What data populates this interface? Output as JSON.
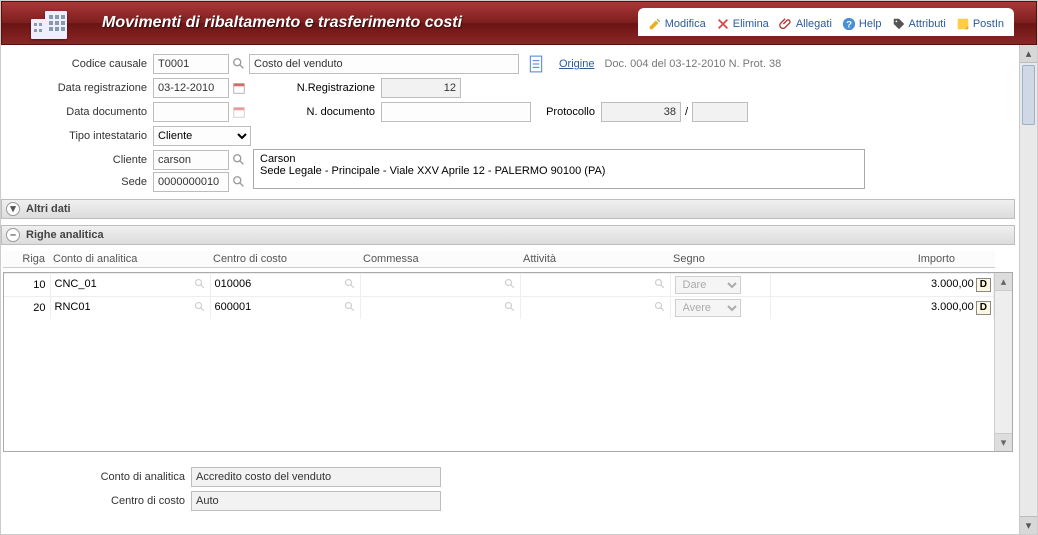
{
  "header": {
    "title": "Movimenti di ribaltamento e trasferimento costi",
    "tools": {
      "modifica": "Modifica",
      "elimina": "Elimina",
      "allegati": "Allegati",
      "help": "Help",
      "attributi": "Attributi",
      "postin": "PostIn"
    }
  },
  "form": {
    "codice_causale_label": "Codice causale",
    "codice_causale": "T0001",
    "codice_causale_desc": "Costo del venduto",
    "origine_label": "Origine",
    "origine_doc": "Doc. 004 del 03-12-2010 N. Prot. 38",
    "data_reg_label": "Data registrazione",
    "data_reg": "03-12-2010",
    "n_reg_label": "N.Registrazione",
    "n_reg": "12",
    "data_doc_label": "Data documento",
    "data_doc": "",
    "n_doc_label": "N. documento",
    "n_doc": "",
    "protocollo_label": "Protocollo",
    "protocollo_a": "38",
    "protocollo_b": "",
    "tipo_int_label": "Tipo intestatario",
    "tipo_int": "Cliente",
    "cliente_label": "Cliente",
    "cliente": "carson",
    "cliente_desc_1": "Carson",
    "cliente_desc_2": "Sede Legale - Principale - Viale XXV Aprile 12 - PALERMO 90100 (PA)",
    "sede_label": "Sede",
    "sede": "0000000010"
  },
  "sections": {
    "altri_dati": "Altri dati",
    "righe": "Righe analitica"
  },
  "grid": {
    "headers": {
      "riga": "Riga",
      "conto": "Conto di analitica",
      "centro": "Centro di costo",
      "commessa": "Commessa",
      "attivita": "Attività",
      "segno": "Segno",
      "importo": "Importo"
    },
    "rows": [
      {
        "riga": "10",
        "conto": "CNC_01",
        "centro": "010006",
        "commessa": "",
        "attivita": "",
        "segno": "Dare",
        "importo": "3.000,00",
        "flag": "D"
      },
      {
        "riga": "20",
        "conto": "RNC01",
        "centro": "600001",
        "commessa": "",
        "attivita": "",
        "segno": "Avere",
        "importo": "3.000,00",
        "flag": "D"
      }
    ]
  },
  "footer": {
    "conto_analitica_label": "Conto di analitica",
    "conto_analitica_value": "Accredito costo del venduto",
    "centro_costo_label": "Centro di costo",
    "centro_costo_value": "Auto"
  }
}
